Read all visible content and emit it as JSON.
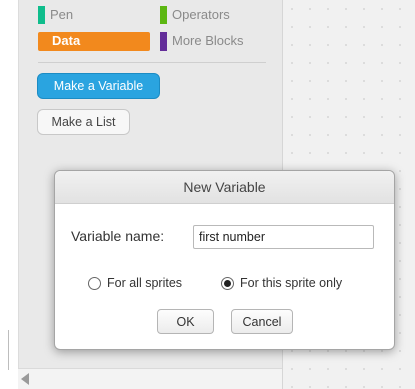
{
  "palette": {
    "categories": [
      {
        "label": "Pen",
        "color": "#0fbd8c",
        "selected": false
      },
      {
        "label": "Operators",
        "color": "#5cb712",
        "selected": false
      },
      {
        "label": "Data",
        "color": "#f2891d",
        "selected": true
      },
      {
        "label": "More Blocks",
        "color": "#632d99",
        "selected": false
      }
    ],
    "make_variable_label": "Make a Variable",
    "make_list_label": "Make a List"
  },
  "dialog": {
    "title": "New Variable",
    "field_label": "Variable name:",
    "field_value": "first number",
    "radio_all_label": "For all sprites",
    "radio_this_label": "For this sprite only",
    "selected_scope": "For this sprite only",
    "ok_label": "OK",
    "cancel_label": "Cancel"
  }
}
